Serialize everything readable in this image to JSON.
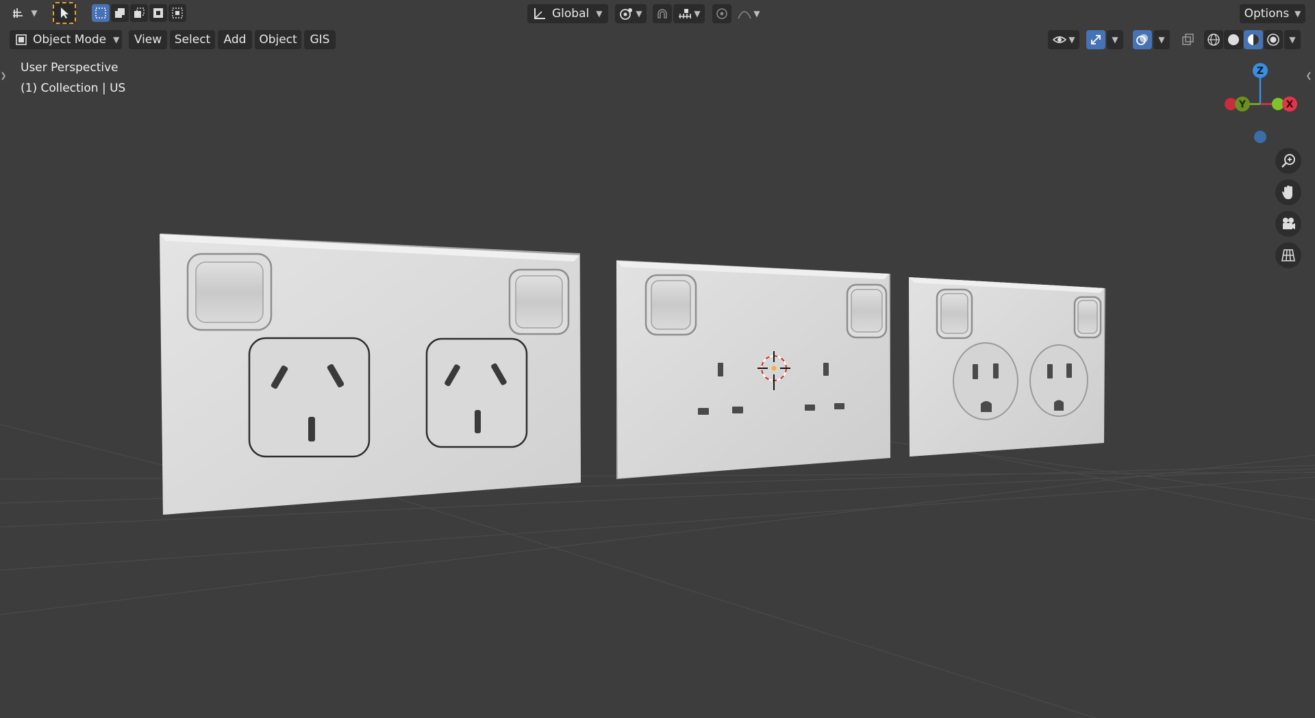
{
  "header": {
    "transform_orientation": "Global",
    "options_label": "Options"
  },
  "mode": {
    "label": "Object Mode"
  },
  "menu": {
    "view": "View",
    "select": "Select",
    "add": "Add",
    "object": "Object",
    "gis": "GIS"
  },
  "overlay": {
    "perspective": "User Perspective",
    "collection": "(1) Collection | US"
  },
  "gizmo": {
    "z": "Z",
    "y": "Y",
    "x": "X"
  },
  "colors": {
    "viewport_bg": "#3d3d3d",
    "header_button": "#2b2b2b",
    "accent": "#4772b3",
    "axis_x": "#e3344a",
    "axis_y": "#82b52a",
    "axis_z": "#3a8fe0"
  }
}
